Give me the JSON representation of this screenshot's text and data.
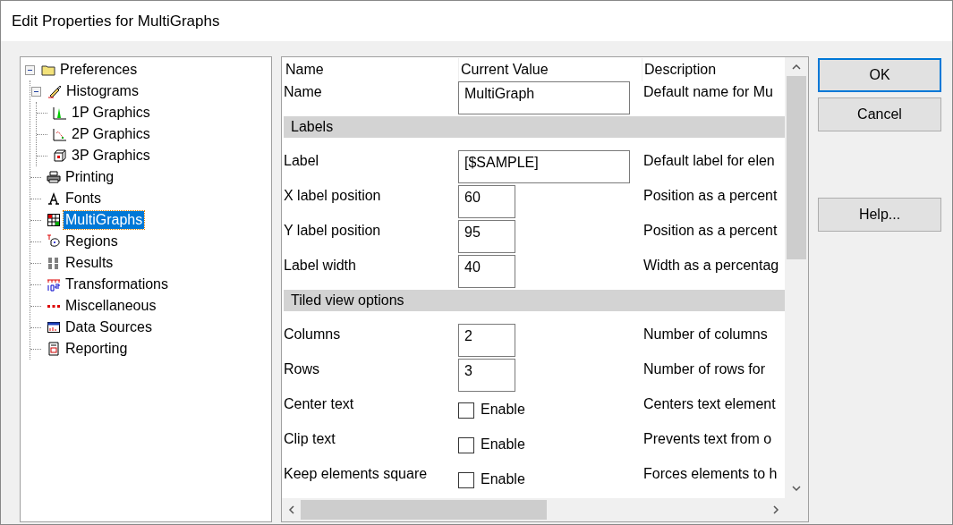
{
  "window": {
    "title": "Edit Properties for MultiGraphs"
  },
  "tree": [
    {
      "label": "Preferences",
      "kind": "folder",
      "selected": false,
      "expanded": true,
      "children": [
        {
          "label": "Histograms",
          "kind": "brush",
          "selected": false,
          "expanded": true,
          "children": [
            {
              "label": "1P Graphics",
              "kind": "peak",
              "selected": false
            },
            {
              "label": "2P Graphics",
              "kind": "scatter",
              "selected": false
            },
            {
              "label": "3P Graphics",
              "kind": "cube",
              "selected": false
            }
          ]
        },
        {
          "label": "Printing",
          "kind": "printer",
          "selected": false
        },
        {
          "label": "Fonts",
          "kind": "font",
          "selected": false
        },
        {
          "label": "MultiGraphs",
          "kind": "grid",
          "selected": true
        },
        {
          "label": "Regions",
          "kind": "regions",
          "selected": false
        },
        {
          "label": "Results",
          "kind": "results",
          "selected": false
        },
        {
          "label": "Transformations",
          "kind": "transform",
          "selected": false
        },
        {
          "label": "Miscellaneous",
          "kind": "dots",
          "selected": false
        },
        {
          "label": "Data Sources",
          "kind": "window",
          "selected": false
        },
        {
          "label": "Reporting",
          "kind": "report",
          "selected": false
        }
      ]
    }
  ],
  "properties": {
    "columns": [
      "Name",
      "Current Value",
      "Description"
    ],
    "rows": [
      {
        "kind": "wide",
        "name": "Name",
        "value": "MultiGraph",
        "description": "Default name for Mu"
      },
      {
        "kind": "section",
        "name": "Labels"
      },
      {
        "kind": "wide",
        "name": "Label",
        "value": "[$SAMPLE]",
        "description": "Default label for elen"
      },
      {
        "kind": "narrow",
        "name": "X label position",
        "value": "60",
        "description": "Position as a percent"
      },
      {
        "kind": "narrow",
        "name": "Y label position",
        "value": "95",
        "description": "Position as a percent"
      },
      {
        "kind": "narrow",
        "name": "Label width",
        "value": "40",
        "description": "Width as a percentag"
      },
      {
        "kind": "section",
        "name": "Tiled view options"
      },
      {
        "kind": "narrow",
        "name": "Columns",
        "value": "2",
        "description": "Number of columns"
      },
      {
        "kind": "narrow",
        "name": "Rows",
        "value": "3",
        "description": "Number of rows for"
      },
      {
        "kind": "checkbox",
        "name": "Center text",
        "checked": false,
        "option": "Enable",
        "description": "Centers text element"
      },
      {
        "kind": "checkbox",
        "name": "Clip text",
        "checked": false,
        "option": "Enable",
        "description": "Prevents text from o"
      },
      {
        "kind": "checkbox",
        "name": "Keep elements square",
        "checked": false,
        "option": "Enable",
        "description": "Forces elements to h"
      }
    ]
  },
  "buttons": [
    {
      "label": "OK",
      "default": true
    },
    {
      "label": "Cancel",
      "default": false
    },
    {
      "label": "Help...",
      "default": false
    }
  ]
}
